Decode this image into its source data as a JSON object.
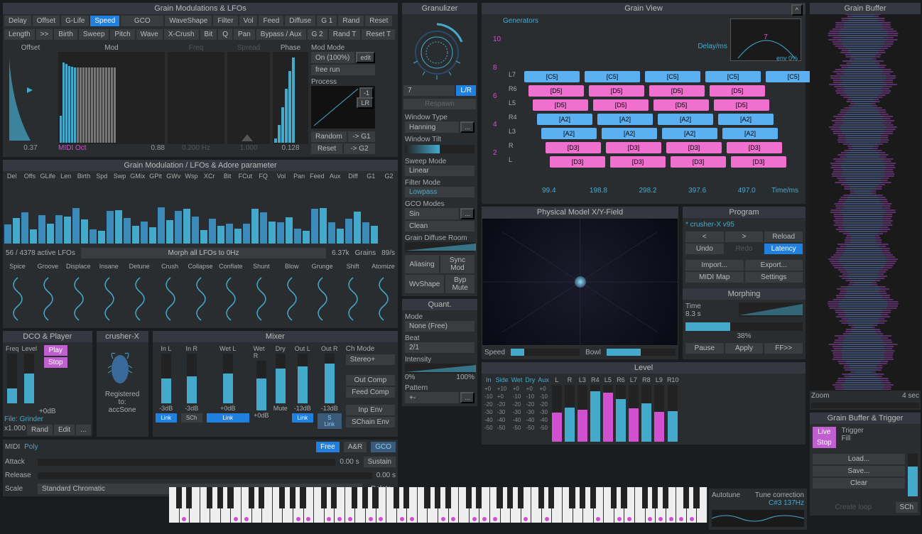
{
  "grain_mod": {
    "title": "Grain Modulations & LFOs",
    "buttons_row1": [
      "Delay",
      "Offset",
      "G-Life",
      "Speed",
      "GCO",
      "WaveShape",
      "Filter",
      "Vol",
      "Feed",
      "Diffuse",
      "G 1",
      "Rand",
      "Reset"
    ],
    "buttons_row2": [
      "Length",
      ">>",
      "Birth",
      "Sweep",
      "Pitch",
      "Wave",
      "X-Crush",
      "Bit",
      "Q",
      "Pan",
      "Bypass / Aux",
      "G 2",
      "Rand T",
      "Reset T"
    ],
    "selected": "Speed",
    "offset": {
      "label": "Offset",
      "value": "0.37",
      "midi": "MIDI Oct"
    },
    "mod": {
      "label": "Mod",
      "value": "0.88"
    },
    "freq": {
      "label": "Freq",
      "value": "0.200 Hz"
    },
    "spread": {
      "label": "Spread",
      "value": "1.000"
    },
    "phase": {
      "label": "Phase",
      "value": "0.128"
    },
    "mod_mode": {
      "label": "Mod Mode",
      "on": "On (100%)",
      "edit": "edit",
      "free_run": "free run"
    },
    "process": {
      "label": "Process",
      "m1": "-1",
      "lr": "LR"
    },
    "random": "Random",
    "g1": "-> G1",
    "reset": "Reset",
    "g2": "-> G2"
  },
  "adore": {
    "title": "Grain Modulation / LFOs & Adore parameter",
    "cols": [
      "Del",
      "Offs",
      "GLife",
      "Len",
      "Birth",
      "Spd",
      "Swp",
      "GMix",
      "GPit",
      "GWv",
      "Wsp",
      "XCr",
      "Bit",
      "FCut",
      "FQ",
      "Vol",
      "Pan",
      "Feed",
      "Aux",
      "Diff",
      "G1",
      "G2"
    ],
    "active": "56 / 4378 active LFOs",
    "morph": "Morph all LFOs to 0Hz",
    "k637": "6.37k",
    "grains": "Grains",
    "rate": "89/s",
    "row2": [
      "Spice",
      "Groove",
      "Displace",
      "Insane",
      "Detune",
      "Crush",
      "Collapse",
      "Conflate",
      "Shunt",
      "Blow",
      "Grunge",
      "Shift",
      "Atomize"
    ]
  },
  "dco": {
    "title": "DCO & Player",
    "freq": "Freq",
    "level": "Level",
    "play": "Play",
    "stop": "Stop",
    "db": "+0dB",
    "file": "File: Grinder",
    "x1": "x1.000",
    "rand": "Rand",
    "edit": "Edit",
    "dots": "..."
  },
  "crusher": {
    "title": "crusher-X",
    "reg": "Registered to:",
    "user": "accSone"
  },
  "mixer": {
    "title": "Mixer",
    "cols": [
      "In L",
      "In R",
      "Wet L",
      "Wet R",
      "Dry",
      "Out L",
      "Out R"
    ],
    "vals": [
      "-3dB",
      "-3dB",
      "+0dB",
      "+0dB",
      "Mute",
      "-13dB",
      "-13dB"
    ],
    "ch_mode": "Ch Mode",
    "stereo": "Stereo+",
    "out_comp": "Out Comp",
    "feed_comp": "Feed Comp",
    "inp_env": "Inp Env",
    "link1": "Link",
    "sch": "SCh",
    "link2": "Link",
    "link3": "Link",
    "slink": "S Link",
    "schain": "SChain Env"
  },
  "midi_panel": {
    "midi": "MIDI",
    "poly": "Poly",
    "free": "Free",
    "ar": "A&R",
    "gco": "GCO",
    "attack": "Attack",
    "attack_v": "0.00 s",
    "sustain": "Sustain",
    "release": "Release",
    "release_v": "0.00 s",
    "scale": "Scale",
    "scale_v": "Standard Chromatic",
    "delete": "Delete"
  },
  "granulizer": {
    "title": "Granulizer",
    "seven": "7",
    "lr": "L/R",
    "respawn": "Respawn",
    "window_type": "Window Type",
    "hanning": "Hanning",
    "window_tilt": "Window Tilt",
    "sweep_mode": "Sweep Mode",
    "linear": "Linear",
    "filter_mode": "Filter Mode",
    "lowpass": "Lowpass",
    "gco_modes": "GCO Modes",
    "sin": "Sin",
    "clean": "Clean",
    "diffuse": "Grain Diffuse Room",
    "aliasing": "Aliasing",
    "sync_mod": "Sync Mod",
    "wvshape": "WvShape",
    "byp_mute": "Byp Mute"
  },
  "quant": {
    "title": "Quant.",
    "mode": "Mode",
    "none": "None (Free)",
    "beat": "Beat",
    "b21": "2/1",
    "intensity": "Intensity",
    "p0": "0%",
    "p100": "100%",
    "pattern": "Pattern",
    "pv": "+-"
  },
  "grain_view": {
    "title": "Grain View",
    "caret": "^",
    "generators": "Generators",
    "delay_ms": "Delay/ms",
    "time_ms": "Time/ms",
    "env_label": "7",
    "env_pct": "env 0%",
    "ticks": [
      "99.4",
      "198.8",
      "298.2",
      "397.6",
      "497.0"
    ],
    "y_ticks": [
      "2",
      "4",
      "6",
      "8",
      "10"
    ],
    "lanes": [
      {
        "label": "L7",
        "notes": [
          "[C5]",
          "[C5]",
          "[C5]",
          "[C5]",
          "[C5]"
        ],
        "color": "blue"
      },
      {
        "label": "R6",
        "notes": [
          "[D5]",
          "[D5]",
          "[D5]",
          "[D5]"
        ],
        "color": "pink"
      },
      {
        "label": "L5",
        "notes": [
          "[D5]",
          "[D5]",
          "[D5]",
          "[D5]"
        ],
        "color": "pink"
      },
      {
        "label": "R4",
        "notes": [
          "[A2]",
          "[A2]",
          "[A2]",
          "[A2]"
        ],
        "color": "blue"
      },
      {
        "label": "L3",
        "notes": [
          "[A2]",
          "[A2]",
          "[A2]",
          "[A2]"
        ],
        "color": "blue"
      },
      {
        "label": "R",
        "notes": [
          "[D3]",
          "[D3]",
          "[D3]",
          "[D3]"
        ],
        "color": "pink"
      },
      {
        "label": "L",
        "notes": [
          "[D3]",
          "[D3]",
          "[D3]",
          "[D3]"
        ],
        "color": "pink"
      }
    ]
  },
  "physical": {
    "title": "Physical Model X/Y-Field",
    "speed": "Speed",
    "bowl": "Bowl"
  },
  "program": {
    "title": "Program",
    "preset": "* crusher-X v95",
    "prev": "<",
    "next": ">",
    "reload": "Reload",
    "undo": "Undo",
    "redo": "Redo",
    "latency": "Latency",
    "import": "Import...",
    "export": "Export...",
    "midi_map": "MIDI Map",
    "settings": "Settings"
  },
  "morphing": {
    "title": "Morphing",
    "time": "Time",
    "time_v": "8.3 s",
    "pct": "38%",
    "pause": "Pause",
    "apply": "Apply",
    "ff": "FF>>"
  },
  "level": {
    "title": "Level",
    "cols": [
      "In",
      "Side",
      "Wet",
      "Dry",
      "Aux",
      "L",
      "R",
      "L3",
      "R4",
      "L5",
      "R6",
      "L7",
      "R8",
      "L9",
      "R10"
    ],
    "marks": [
      "+0",
      "+10",
      "-20",
      "-30",
      "-40",
      "-50"
    ]
  },
  "autotune": {
    "autotune": "Autotune",
    "tune": "Tune correction",
    "note": "C#3 137Hz"
  },
  "grain_buffer": {
    "title": "Grain Buffer",
    "zoom": "Zoom",
    "sec": "4 sec"
  },
  "trigger": {
    "title": "Grain Buffer & Trigger",
    "live": "Live",
    "stop": "Stop",
    "trig": "Trigger",
    "fill": "Fill",
    "load": "Load...",
    "save": "Save...",
    "clear": "Clear",
    "create": "Create loop",
    "sch": "SCh"
  }
}
